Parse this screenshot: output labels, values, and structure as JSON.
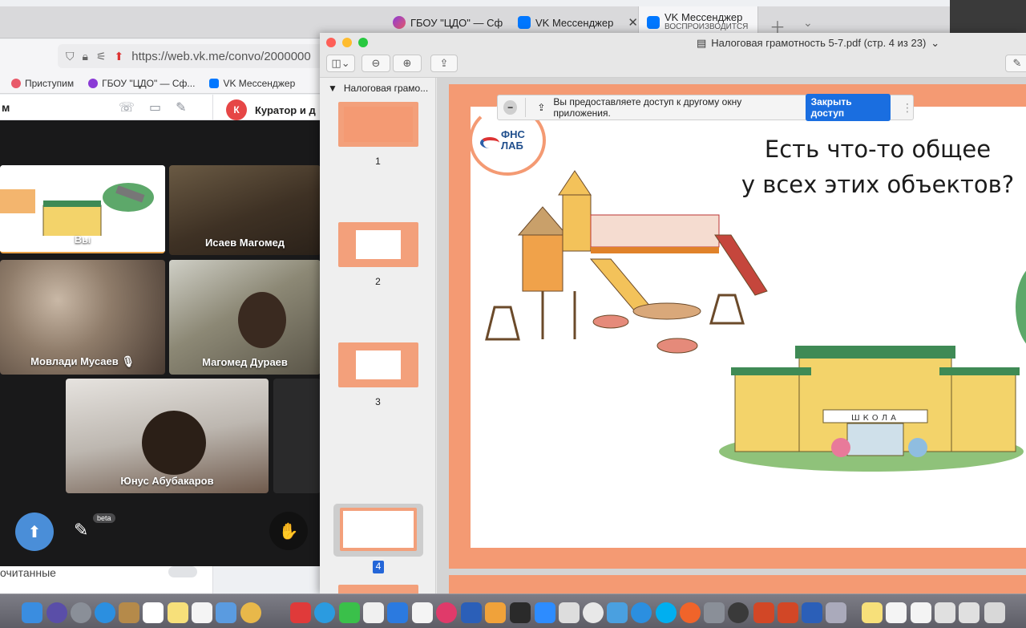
{
  "browser": {
    "tabs": [
      {
        "label": "ГБОУ \"ЦДО\" — Сф",
        "icon": "gboy-icon",
        "color": "#8b3bd6"
      },
      {
        "label": "VK Мессенджер",
        "icon": "vk-icon",
        "color": "#0077ff"
      },
      {
        "label": "VK Мессенджер",
        "sublabel": "ВОСПРОИЗВОДИТСЯ",
        "icon": "vk-icon",
        "color": "#0077ff",
        "active": true
      }
    ],
    "url": "https://web.vk.me/convo/2000000",
    "bookmarks": [
      {
        "label": "Приступим",
        "color": "#e85a6a"
      },
      {
        "label": "ГБОУ \"ЦДО\" — Сф...",
        "color": "#8b3bd6"
      },
      {
        "label": "VK Мессенджер",
        "color": "#0077ff"
      }
    ]
  },
  "vk": {
    "header_title": "м",
    "chat_avatar": "К",
    "chat_title": "Куратор и д",
    "unread_label": "очитанные"
  },
  "call": {
    "participants": [
      {
        "name": "Вы"
      },
      {
        "name": "Исаев Магомед"
      },
      {
        "name": "Мовлади Мусаев",
        "muted": true
      },
      {
        "name": "Магомед Дураев"
      },
      {
        "name": "Юнус Абубакаров"
      }
    ],
    "beta_label": "beta"
  },
  "preview": {
    "title": "Налоговая грамотность 5-7.pdf (стр. 4 из 23)",
    "sidebar_title": "Налоговая грамо...",
    "pages": [
      "1",
      "2",
      "3",
      "4"
    ],
    "current_page": "4"
  },
  "share_banner": {
    "text": "Вы предоставляете доступ к другому окну приложения.",
    "stop_label": "Закрыть доступ"
  },
  "slide": {
    "title_line1": "Есть что-то общее",
    "title_line2": "у всех этих объектов?",
    "logo_line1": "ФНС",
    "logo_line2": "ЛАБ",
    "school_sign": "ШКОЛА"
  },
  "colors": {
    "slide_orange": "#f49a73",
    "vk_blue": "#0077ff",
    "stop_button": "#1a6ee0"
  }
}
